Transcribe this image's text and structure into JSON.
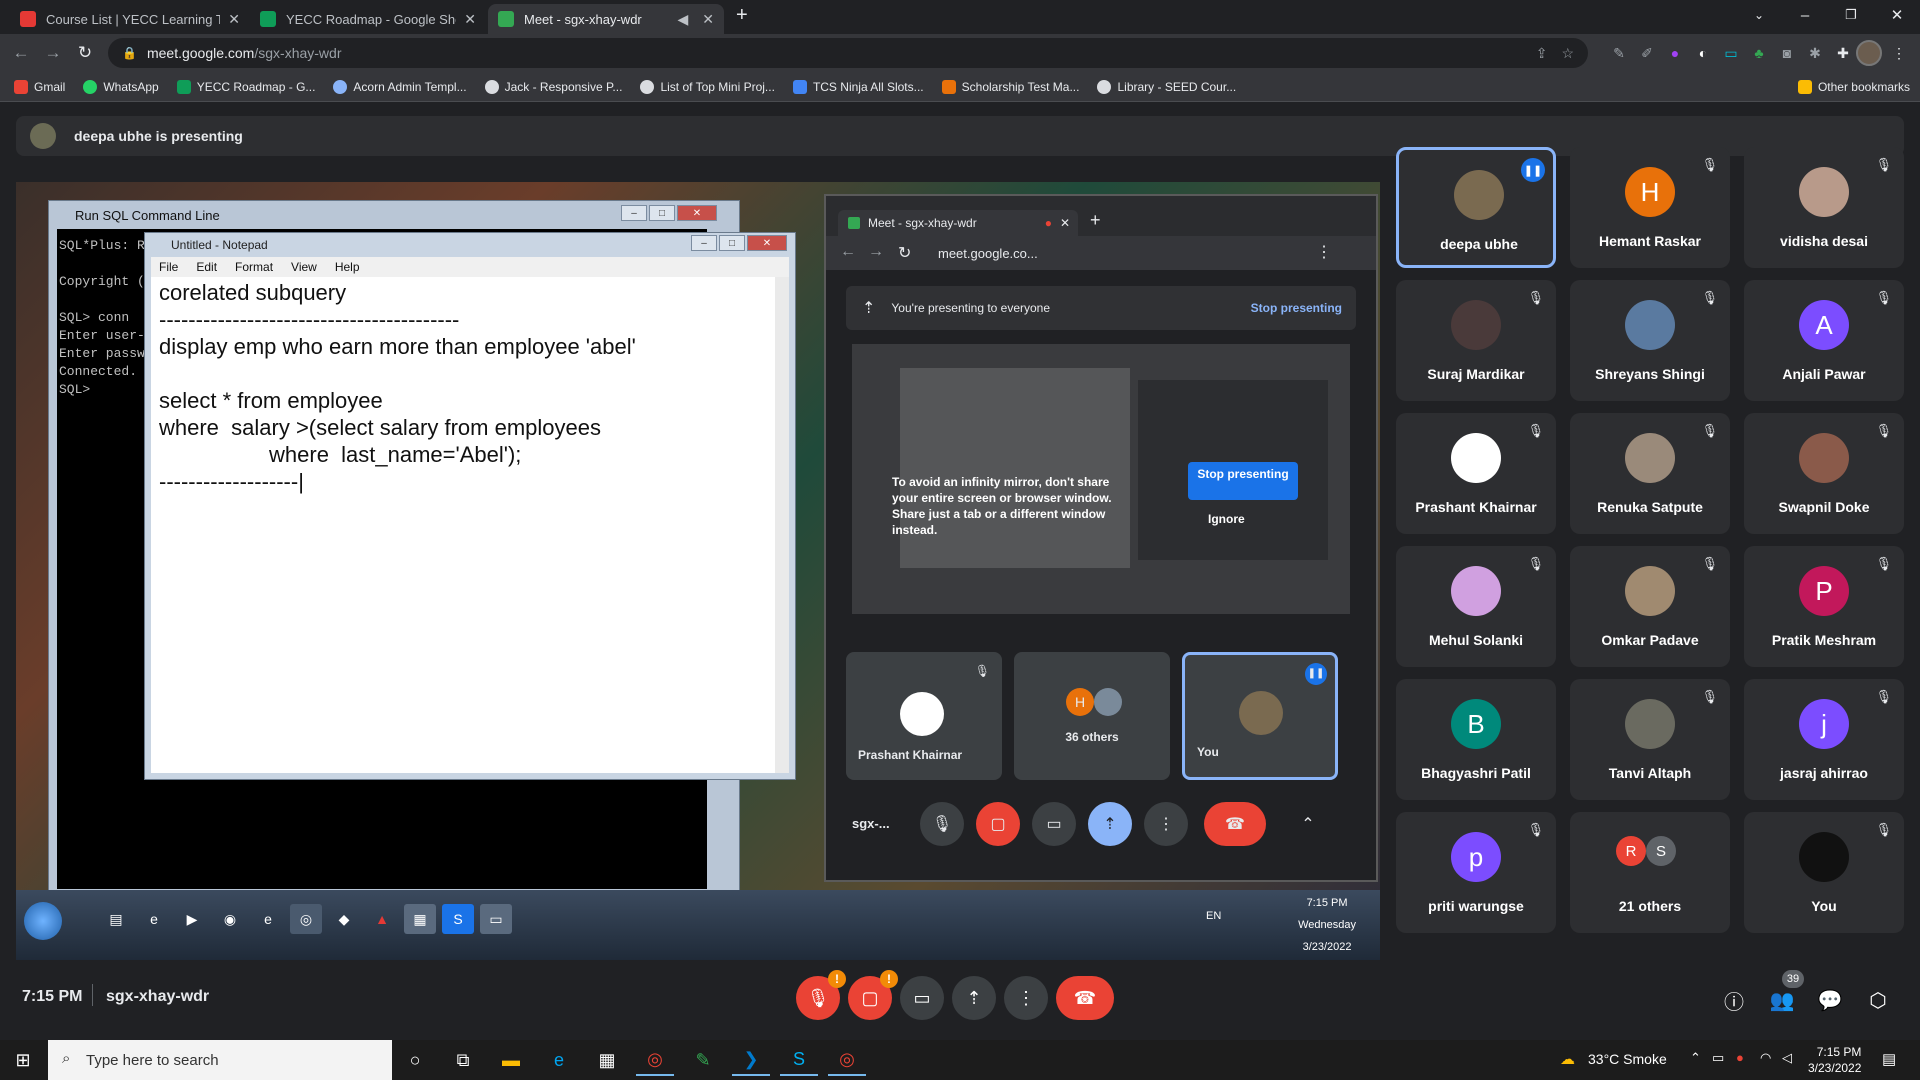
{
  "tabs": [
    {
      "title": "Course List | YECC Learning Techn",
      "color": "#e53935"
    },
    {
      "title": "YECC Roadmap - Google Sheets",
      "color": "#0f9d58"
    },
    {
      "title": "Meet - sgx-xhay-wdr",
      "color": "#34a853"
    }
  ],
  "omnibox": {
    "host": "meet.google.com",
    "path": "/sgx-xhay-wdr"
  },
  "bookmarks": [
    {
      "label": "Gmail",
      "color": "#ea4335"
    },
    {
      "label": "WhatsApp",
      "color": "#25d366"
    },
    {
      "label": "YECC Roadmap - G...",
      "color": "#0f9d58"
    },
    {
      "label": "Acorn Admin Templ...",
      "color": "#8ab4f8"
    },
    {
      "label": "Jack - Responsive P...",
      "color": "#dadce0"
    },
    {
      "label": "List of Top Mini Proj...",
      "color": "#dadce0"
    },
    {
      "label": "TCS Ninja All Slots...",
      "color": "#4285f4"
    },
    {
      "label": "Scholarship Test Ma...",
      "color": "#e8710a"
    },
    {
      "label": "Library - SEED Cour...",
      "color": "#dadce0"
    }
  ],
  "other_bookmarks": "Other bookmarks",
  "presenting_banner": "deepa ubhe is presenting",
  "shared_screen": {
    "sql_title": "Run SQL Command Line",
    "sql_console": "SQL*Plus: R\n\nCopyright (\n\nSQL> conn\nEnter user-\nEnter passw\nConnected.\nSQL>",
    "notepad_title": "Untitled - Notepad",
    "notepad_menu": [
      "File",
      "Edit",
      "Format",
      "View",
      "Help"
    ],
    "notepad_text": "corelated subquery\n-----------------------------------------\ndisplay emp who earn more than employee 'abel'\n\nselect * from employee\nwhere  salary >(select salary from employees\n                  where  last_name='Abel');\n-------------------|",
    "inner_meet": {
      "tab_title": "Meet - sgx-xhay-wdr",
      "url": "meet.google.co...",
      "banner_text": "You're presenting to everyone",
      "banner_action": "Stop presenting",
      "warning": "To avoid an infinity mirror, don't share your entire screen or browser window. Share just a tab or a different window instead.",
      "stop_button": "Stop presenting",
      "ignore": "Ignore",
      "tiles": [
        "Prashant Khairnar",
        "36 others",
        "You"
      ],
      "meeting_code": "sgx-..."
    },
    "taskbar": {
      "lang": "EN",
      "time": "7:15 PM",
      "day": "Wednesday",
      "date": "3/23/2022"
    }
  },
  "participants": [
    {
      "name": "deepa ubhe",
      "initial": "",
      "color": "#7a6a50",
      "active": true,
      "muted": false
    },
    {
      "name": "Hemant Raskar",
      "initial": "H",
      "color": "#e8710a",
      "active": false,
      "muted": true
    },
    {
      "name": "vidisha desai",
      "initial": "",
      "color": "#b89a8a",
      "active": false,
      "muted": true
    },
    {
      "name": "Suraj Mardikar",
      "initial": "",
      "color": "#4a3a3a",
      "active": false,
      "muted": true
    },
    {
      "name": "Shreyans Shingi",
      "initial": "",
      "color": "#5a7aa0",
      "active": false,
      "muted": true
    },
    {
      "name": "Anjali Pawar",
      "initial": "A",
      "color": "#7c4dff",
      "active": false,
      "muted": true
    },
    {
      "name": "Prashant Khairnar",
      "initial": "",
      "color": "#ffffff",
      "active": false,
      "muted": true
    },
    {
      "name": "Renuka Satpute",
      "initial": "",
      "color": "#9a8a7a",
      "active": false,
      "muted": true
    },
    {
      "name": "Swapnil Doke",
      "initial": "",
      "color": "#8a5a4a",
      "active": false,
      "muted": true
    },
    {
      "name": "Mehul Solanki",
      "initial": "",
      "color": "#d0a0e0",
      "active": false,
      "muted": true
    },
    {
      "name": "Omkar Padave",
      "initial": "",
      "color": "#a08a70",
      "active": false,
      "muted": true
    },
    {
      "name": "Pratik Meshram",
      "initial": "P",
      "color": "#c2185b",
      "active": false,
      "muted": true
    },
    {
      "name": "Bhagyashri Patil",
      "initial": "B",
      "color": "#00897b",
      "active": false,
      "muted": false
    },
    {
      "name": "Tanvi Altaph",
      "initial": "",
      "color": "#6a6a60",
      "active": false,
      "muted": true
    },
    {
      "name": "jasraj ahirrao",
      "initial": "j",
      "color": "#7c4dff",
      "active": false,
      "muted": true
    },
    {
      "name": "priti warungse",
      "initial": "p",
      "color": "#7c4dff",
      "active": false,
      "muted": true
    },
    {
      "name": "21 others",
      "initial": "",
      "color": "#2d2e31",
      "active": false,
      "muted": false
    },
    {
      "name": "You",
      "initial": "",
      "color": "#111111",
      "active": false,
      "muted": true
    }
  ],
  "others_avatars": [
    "R",
    "S"
  ],
  "meet_bar": {
    "time": "7:15 PM",
    "code": "sgx-xhay-wdr",
    "participant_count": "39"
  },
  "win_taskbar": {
    "search_placeholder": "Type here to search",
    "weather": "33°C  Smoke",
    "time": "7:15 PM",
    "date": "3/23/2022"
  }
}
